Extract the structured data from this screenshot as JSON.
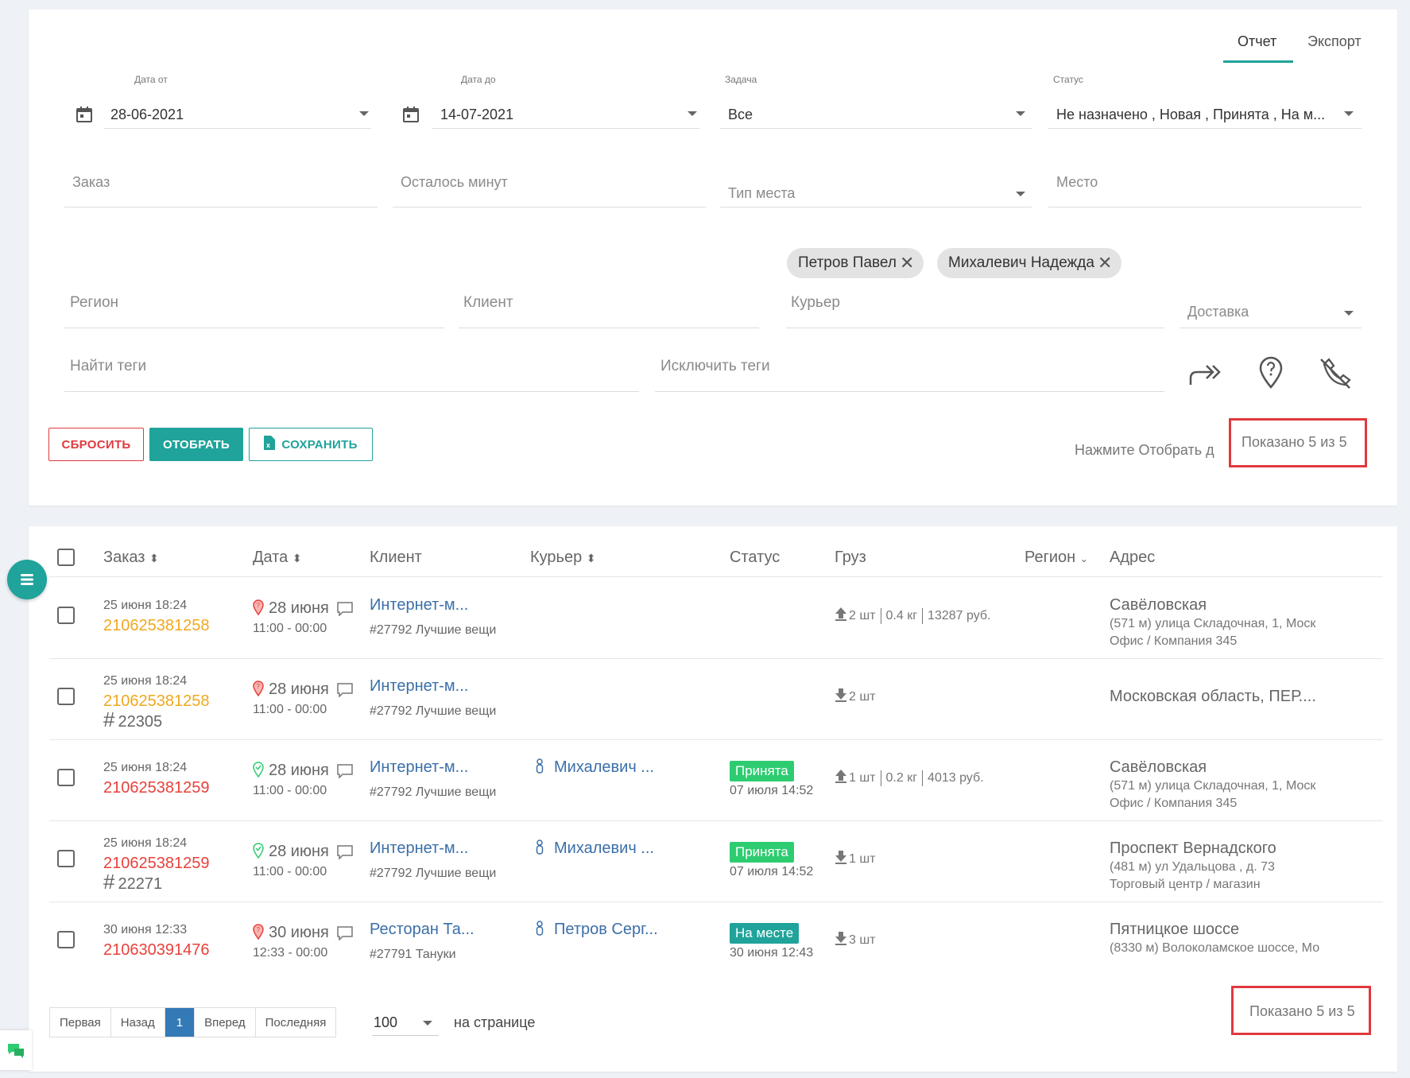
{
  "tabs": {
    "report": "Отчет",
    "export": "Экспорт"
  },
  "filters": {
    "date_from": {
      "label": "Дата от",
      "value": "28-06-2021"
    },
    "date_to": {
      "label": "Дата до",
      "value": "14-07-2021"
    },
    "task": {
      "label": "Задача",
      "value": "Все"
    },
    "status": {
      "label": "Статус",
      "value": "Не назначено , Новая , Принята , На м..."
    },
    "order": {
      "placeholder": "Заказ"
    },
    "minutes_left": {
      "placeholder": "Осталось минут"
    },
    "place_type": {
      "placeholder": "Тип места"
    },
    "place": {
      "placeholder": "Место"
    },
    "courier_chips": [
      "Петров Павел",
      "Михалевич Надежда"
    ],
    "region": {
      "placeholder": "Регион"
    },
    "client": {
      "placeholder": "Клиент"
    },
    "courier": {
      "placeholder": "Курьер"
    },
    "delivery": {
      "placeholder": "Доставка"
    },
    "find_tags": {
      "placeholder": "Найти теги"
    },
    "exclude_tags": {
      "placeholder": "Исключить теги"
    }
  },
  "buttons": {
    "reset": "СБРОСИТЬ",
    "select": "ОТОБРАТЬ",
    "save": "СОХРАНИТЬ"
  },
  "hint": "Нажмите Отобрать д",
  "shown_top": "Показано 5 из 5",
  "table": {
    "headers": {
      "order": "Заказ",
      "date": "Дата",
      "client": "Клиент",
      "courier": "Курьер",
      "status": "Статус",
      "cargo": "Груз",
      "region": "Регион",
      "address": "Адрес"
    },
    "rows": [
      {
        "created": "25 июня 18:24",
        "order": "210625381258",
        "order_color": "#f0a81e",
        "tag": "",
        "date": "28 июня",
        "time": "11:00 - 00:00",
        "pin": "red",
        "client": "Интернет-м...",
        "client_sub": "#27792 Лучшие вещи",
        "courier": "",
        "status": "",
        "status_color": "",
        "status_time": "",
        "cargo_dir": "up",
        "cargo": [
          "2 шт",
          "0.4 кг",
          "13287 руб."
        ],
        "addr1": "Савёловская",
        "addr2": "(571 м) улица Складочная, 1, Моск",
        "addr3": "Офис / Компания 345"
      },
      {
        "created": "25 июня 18:24",
        "order": "210625381258",
        "order_color": "#f0a81e",
        "tag": "22305",
        "date": "28 июня",
        "time": "11:00 - 00:00",
        "pin": "red",
        "client": "Интернет-м...",
        "client_sub": "#27792 Лучшие вещи",
        "courier": "",
        "status": "",
        "status_color": "",
        "status_time": "",
        "cargo_dir": "down",
        "cargo": [
          "2 шт"
        ],
        "addr1": "Московская область, ПЕР....",
        "addr2": "",
        "addr3": ""
      },
      {
        "created": "25 июня 18:24",
        "order": "210625381259",
        "order_color": "#e8413a",
        "tag": "",
        "date": "28 июня",
        "time": "11:00 - 00:00",
        "pin": "green",
        "client": "Интернет-м...",
        "client_sub": "#27792 Лучшие вещи",
        "courier": "Михалевич ...",
        "status": "Принята",
        "status_color": "#2ecc71",
        "status_time": "07 июля 14:52",
        "cargo_dir": "up",
        "cargo": [
          "1 шт",
          "0.2 кг",
          "4013 руб."
        ],
        "addr1": "Савёловская",
        "addr2": "(571 м) улица Складочная, 1, Моск",
        "addr3": "Офис / Компания 345"
      },
      {
        "created": "25 июня 18:24",
        "order": "210625381259",
        "order_color": "#e8413a",
        "tag": "22271",
        "date": "28 июня",
        "time": "11:00 - 00:00",
        "pin": "green",
        "client": "Интернет-м...",
        "client_sub": "#27792 Лучшие вещи",
        "courier": "Михалевич ...",
        "status": "Принята",
        "status_color": "#2ecc71",
        "status_time": "07 июля 14:52",
        "cargo_dir": "down",
        "cargo": [
          "1 шт"
        ],
        "addr1": "Проспект Вернадского",
        "addr2": "(481 м) ул Удальцова , д. 73",
        "addr3": "Торговый центр / магазин"
      },
      {
        "created": "30 июня 12:33",
        "order": "210630391476",
        "order_color": "#e8413a",
        "tag": "",
        "date": "30 июня",
        "time": "12:33 - 00:00",
        "pin": "red",
        "client": "Ресторан Та...",
        "client_sub": "#27791 Тануки",
        "courier": "Петров Серг...",
        "status": "На месте",
        "status_color": "#1fa39a",
        "status_time": "30 июня 12:43",
        "cargo_dir": "down",
        "cargo": [
          "3 шт"
        ],
        "addr1": "Пятницкое шоссе",
        "addr2": "(8330 м) Волоколамское шоссе, Мо",
        "addr3": ""
      }
    ]
  },
  "pagination": {
    "first": "Первая",
    "prev": "Назад",
    "current": "1",
    "next": "Вперед",
    "last": "Последняя",
    "per_page": "100",
    "per_page_label": "на странице"
  },
  "shown_bottom": "Показано 5 из 5"
}
